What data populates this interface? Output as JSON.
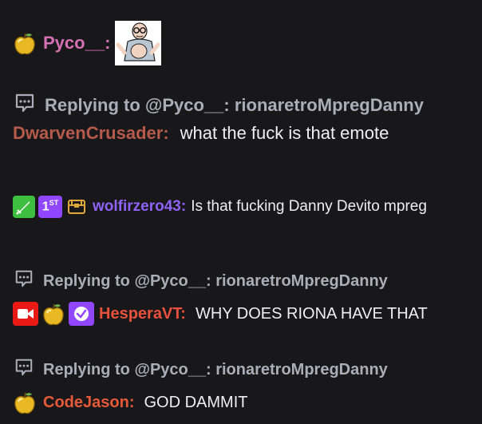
{
  "colors": {
    "background": "#18181b",
    "text": "#efeff1",
    "muted": "#adadb8",
    "pyco": "#d670b4",
    "dwarven": "#b65a4c",
    "wolfir": "#8f62f8",
    "hespera": "#e8513c",
    "codejason": "#e65a3a"
  },
  "messages": [
    {
      "badges": [
        "golden-apple-badge"
      ],
      "username": "Pyco__",
      "separator": ":",
      "emote": "rionaretroMpregDanny"
    },
    {
      "reply_label": "Replying to @Pyco__: rionaretroMpregDanny",
      "username": "DwarvenCrusader",
      "separator": ":",
      "text": "what the fuck is that emote"
    },
    {
      "badges": [
        "sword-badge",
        "first-badge",
        "chest-badge"
      ],
      "badge_first_text": "ST",
      "badge_first_num": "1",
      "username": "wolfirzero43",
      "separator": ":",
      "text": "Is that fucking Danny Devito mpreg"
    },
    {
      "reply_label": "Replying to @Pyco__: rionaretroMpregDanny",
      "badges": [
        "video-badge",
        "golden-apple-badge",
        "verified-badge"
      ],
      "username": "HesperaVT",
      "separator": ":",
      "text": "WHY DOES RIONA HAVE THAT"
    },
    {
      "reply_label": "Replying to @Pyco__: rionaretroMpregDanny",
      "badges": [
        "golden-apple-badge"
      ],
      "username": "CodeJason",
      "separator": ":",
      "text": "GOD DAMMIT"
    }
  ]
}
